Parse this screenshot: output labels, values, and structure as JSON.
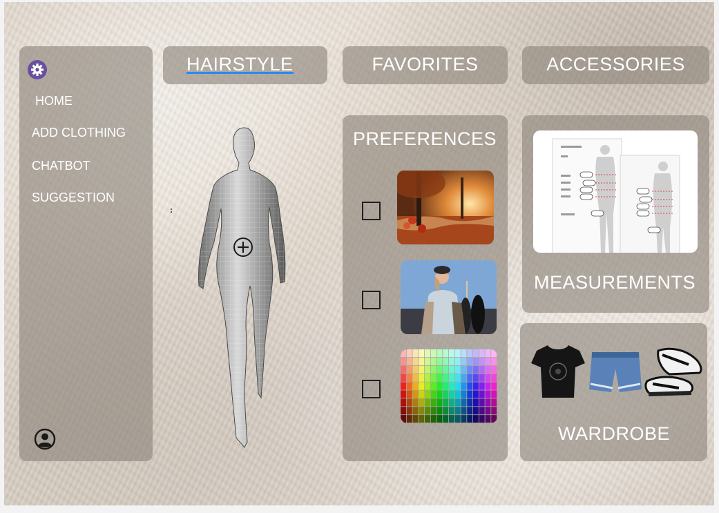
{
  "sidebar": {
    "items": [
      {
        "label": "HOME"
      },
      {
        "label": "ADD CLOTHING"
      },
      {
        "label": "CHATBOT"
      },
      {
        "label": "SUGGESTION"
      }
    ]
  },
  "tabs": {
    "hairstyle": "HAIRSTYLE",
    "favorites": "FAVORITES",
    "accessories": "ACCESSORIES"
  },
  "preferences": {
    "title": "PREFERENCES"
  },
  "measurements": {
    "title": "MEASUREMENTS"
  },
  "wardrobe": {
    "title": "WARDROBE"
  },
  "colors": {
    "panel": "#8c847a",
    "accent_underline": "#2b8af0",
    "gear_bg": "#6a4fa0",
    "text": "#ffffff"
  },
  "icons": [
    "gear-icon",
    "user-circle-icon",
    "add-circle-icon",
    "more-vertical-icon"
  ]
}
